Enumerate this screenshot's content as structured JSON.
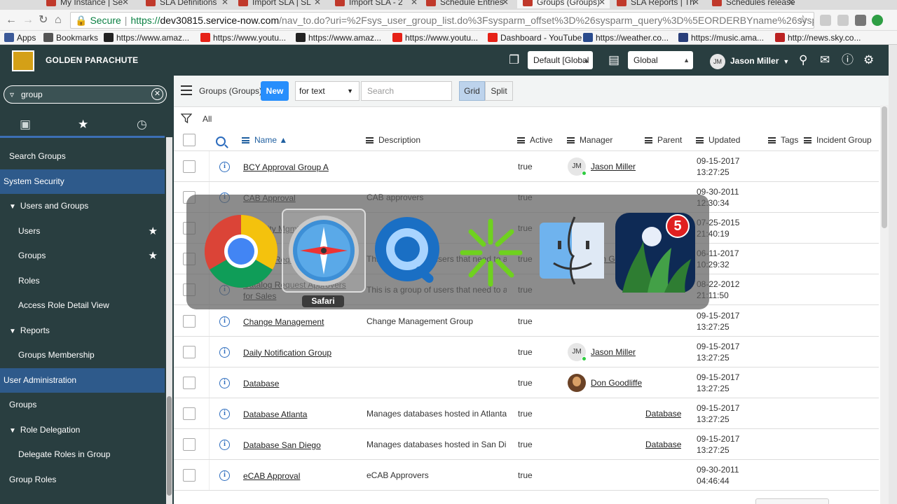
{
  "browser": {
    "tabs": [
      {
        "title": "My Instance | Se"
      },
      {
        "title": "SLA Definitions"
      },
      {
        "title": "Import SLA | SL"
      },
      {
        "title": "Import SLA - 2"
      },
      {
        "title": "Schedule Entries"
      },
      {
        "title": "Groups (Groups)"
      },
      {
        "title": "SLA Reports | Th"
      },
      {
        "title": "Schedules release"
      }
    ],
    "url": {
      "secure_label": "Secure",
      "scheme": "https://",
      "host": "dev30815.service-now.com",
      "path": "/nav_to.do?uri=%2Fsys_user_group_list.do%3Fsysparm_offset%3D%26sysparm_query%3D%5EORDERBYname%26sysparm_l..."
    },
    "bookmarks": [
      {
        "label": "Apps"
      },
      {
        "label": "Bookmarks"
      },
      {
        "label": "https://www.amaz..."
      },
      {
        "label": "https://www.youtu..."
      },
      {
        "label": "https://www.amaz..."
      },
      {
        "label": "https://www.youtu..."
      },
      {
        "label": "Dashboard - YouTube"
      },
      {
        "label": "https://weather.co..."
      },
      {
        "label": "https://music.ama..."
      },
      {
        "label": "http://news.sky.co..."
      }
    ]
  },
  "header": {
    "brand": "GOLDEN PARACHUTE",
    "update_set": "Default [Global",
    "scope": "Global",
    "user_initials": "JM",
    "user_name": "Jason Miller"
  },
  "sidebar": {
    "filter_value": "group",
    "items": [
      {
        "label": "Search Groups",
        "level": 1
      },
      {
        "label": "System Security",
        "level": 0,
        "highlight": true
      },
      {
        "label": "Users and Groups",
        "level": 1,
        "expanded": true
      },
      {
        "label": "Users",
        "level": 2,
        "star": true
      },
      {
        "label": "Groups",
        "level": 2,
        "star": true
      },
      {
        "label": "Roles",
        "level": 2
      },
      {
        "label": "Access Role Detail View",
        "level": 2
      },
      {
        "label": "Reports",
        "level": 1,
        "expanded": true
      },
      {
        "label": "Groups Membership",
        "level": 2
      },
      {
        "label": "User Administration",
        "level": 0,
        "highlight": true
      },
      {
        "label": "Groups",
        "level": 1
      },
      {
        "label": "Role Delegation",
        "level": 1,
        "expanded": true
      },
      {
        "label": "Delegate Roles in Group",
        "level": 2
      },
      {
        "label": "Group Roles",
        "level": 1
      }
    ]
  },
  "list": {
    "title": "Groups (Groups)",
    "new_label": "New",
    "search_field": "for text",
    "search_placeholder": "Search",
    "view_grid": "Grid",
    "view_split": "Split",
    "breadcrumb": "All",
    "columns": {
      "name": "Name",
      "description": "Description",
      "active": "Active",
      "manager": "Manager",
      "parent": "Parent",
      "updated": "Updated",
      "tags": "Tags",
      "incident_group": "Incident Group"
    },
    "rows": [
      {
        "name": "BCY Approval Group A",
        "description": "",
        "active": "true",
        "manager": "Jason Miller",
        "manager_avatar": "JM",
        "parent": "",
        "updated_date": "09-15-2017",
        "updated_time": "13:27:25"
      },
      {
        "name": "CAB Approval",
        "description": "CAB approvers",
        "active": "true",
        "manager": "",
        "manager_avatar": "",
        "parent": "",
        "updated_date": "09-30-2011",
        "updated_time": "12:30:34"
      },
      {
        "name": "Capacity Mgmt",
        "description": "",
        "active": "true",
        "manager": "",
        "manager_avatar": "",
        "parent": "",
        "updated_date": "07-25-2015",
        "updated_time": "21:40:19"
      },
      {
        "name": "Catalog Request Approvers",
        "description": "This is a group of users that need to ap...",
        "active": "true",
        "manager": "Don Goodliffe",
        "manager_avatar": "photo",
        "parent": "",
        "updated_date": "06-11-2017",
        "updated_time": "10:29:32"
      },
      {
        "name": "Catalog Request Approvers for Sales",
        "description": "This is a group of users that need to ap...",
        "active": "true",
        "manager": "",
        "manager_avatar": "",
        "parent": "",
        "updated_date": "08-22-2012",
        "updated_time": "21:11:50"
      },
      {
        "name": "Change Management",
        "description": "Change Management Group",
        "active": "true",
        "manager": "",
        "manager_avatar": "",
        "parent": "",
        "updated_date": "09-15-2017",
        "updated_time": "13:27:25"
      },
      {
        "name": "Daily Notification Group",
        "description": "",
        "active": "true",
        "manager": "Jason Miller",
        "manager_avatar": "JM",
        "parent": "",
        "updated_date": "09-15-2017",
        "updated_time": "13:27:25"
      },
      {
        "name": "Database",
        "description": "",
        "active": "true",
        "manager": "Don Goodliffe",
        "manager_avatar": "photo",
        "parent": "",
        "updated_date": "09-15-2017",
        "updated_time": "13:27:25"
      },
      {
        "name": "Database Atlanta",
        "description": "Manages databases hosted in Atlanta",
        "active": "true",
        "manager": "",
        "manager_avatar": "",
        "parent": "Database",
        "updated_date": "09-15-2017",
        "updated_time": "13:27:25"
      },
      {
        "name": "Database San Diego",
        "description": "Manages databases hosted in San Diego",
        "active": "true",
        "manager": "",
        "manager_avatar": "",
        "parent": "Database",
        "updated_date": "09-15-2017",
        "updated_time": "13:27:25"
      },
      {
        "name": "eCAB Approval",
        "description": "eCAB Approvers",
        "active": "true",
        "manager": "",
        "manager_avatar": "",
        "parent": "",
        "updated_date": "09-30-2011",
        "updated_time": "04:46:44"
      }
    ]
  },
  "app_switcher": {
    "apps": [
      "chrome-icon",
      "safari-icon",
      "quicktime-icon",
      "spark-icon",
      "finder-icon",
      "moon-app-icon"
    ],
    "selected_label": "Safari",
    "badge_count": "5"
  }
}
